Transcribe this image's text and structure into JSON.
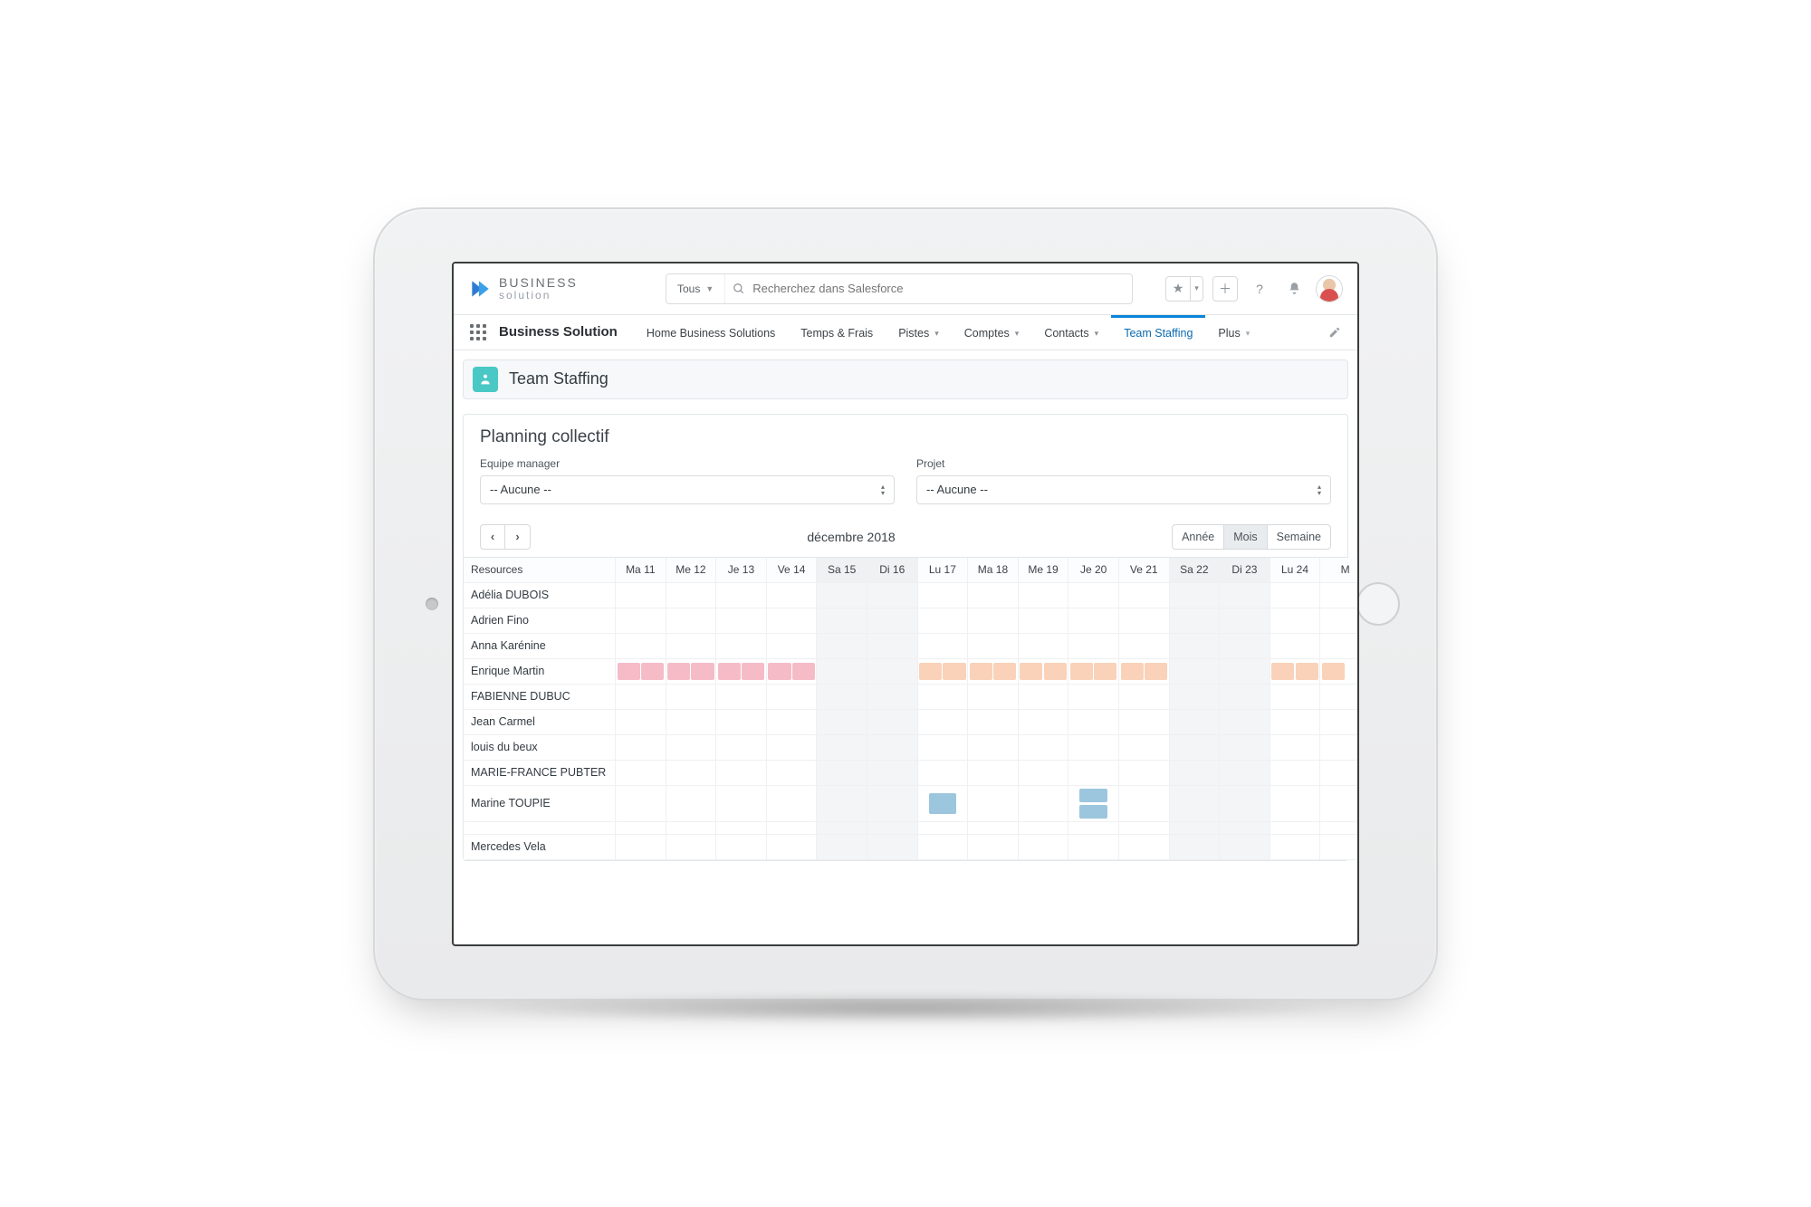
{
  "brand": {
    "top": "BUSINESS",
    "bottom": "solution"
  },
  "search": {
    "scope": "Tous",
    "placeholder": "Recherchez dans Salesforce"
  },
  "nav": {
    "appName": "Business Solution",
    "tabs": [
      {
        "label": "Home Business Solutions",
        "hasMenu": false
      },
      {
        "label": "Temps & Frais",
        "hasMenu": false
      },
      {
        "label": "Pistes",
        "hasMenu": true
      },
      {
        "label": "Comptes",
        "hasMenu": true
      },
      {
        "label": "Contacts",
        "hasMenu": true
      },
      {
        "label": "Team Staffing",
        "hasMenu": false,
        "active": true
      },
      {
        "label": "Plus",
        "hasMenu": true,
        "plus": true
      }
    ]
  },
  "page": {
    "title": "Team Staffing"
  },
  "planning": {
    "title": "Planning collectif",
    "manager": {
      "label": "Equipe manager",
      "value": "-- Aucune --"
    },
    "project": {
      "label": "Projet",
      "value": "-- Aucune --"
    },
    "month": "décembre 2018",
    "views": {
      "year": "Année",
      "month": "Mois",
      "week": "Semaine",
      "active": "month"
    },
    "daysHeader": "Resources",
    "days": [
      {
        "lbl": "Ma 11",
        "we": false
      },
      {
        "lbl": "Me 12",
        "we": false
      },
      {
        "lbl": "Je 13",
        "we": false
      },
      {
        "lbl": "Ve 14",
        "we": false
      },
      {
        "lbl": "Sa 15",
        "we": true
      },
      {
        "lbl": "Di 16",
        "we": true
      },
      {
        "lbl": "Lu 17",
        "we": false
      },
      {
        "lbl": "Ma 18",
        "we": false
      },
      {
        "lbl": "Me 19",
        "we": false
      },
      {
        "lbl": "Je 20",
        "we": false
      },
      {
        "lbl": "Ve 21",
        "we": false
      },
      {
        "lbl": "Sa 22",
        "we": true
      },
      {
        "lbl": "Di 23",
        "we": true
      },
      {
        "lbl": "Lu 24",
        "we": false
      },
      {
        "lbl": "M",
        "we": false
      }
    ],
    "resources": [
      "Adélia DUBOIS",
      "Adrien Fino",
      "Anna Karénine",
      "Enrique Martin",
      "FABIENNE DUBUC",
      "Jean Carmel",
      "louis du beux",
      "MARIE-FRANCE PUBTER",
      "Marine TOUPIE",
      "",
      "Mercedes Vela"
    ],
    "assignments": {
      "Enrique Martin": {
        "0": [
          "pink",
          "pink"
        ],
        "1": [
          "pink",
          "pink"
        ],
        "2": [
          "pink",
          "pink"
        ],
        "3": [
          "pink",
          "pink"
        ],
        "6": [
          "peach",
          "peach"
        ],
        "7": [
          "peach",
          "peach"
        ],
        "8": [
          "peach",
          "peach"
        ],
        "9": [
          "peach",
          "peach"
        ],
        "10": [
          "peach",
          "peach"
        ],
        "13": [
          "peach",
          "peach"
        ],
        "14": [
          "peach",
          null
        ]
      },
      "Marine TOUPIE": {
        "6": "single-blue",
        "9": "double-blue"
      }
    }
  }
}
